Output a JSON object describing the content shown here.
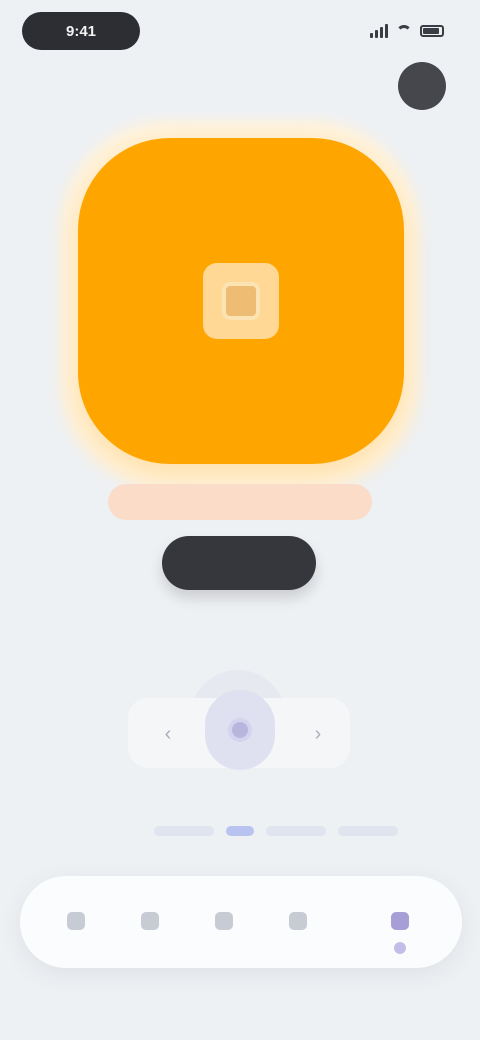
{
  "status_bar": {
    "time": "9:41",
    "signal_icon": "signal-icon",
    "wifi_icon": "wifi-icon",
    "battery_icon": "battery-icon"
  },
  "header": {
    "back_label": "",
    "title": "",
    "avatar_initials": ""
  },
  "hero": {
    "accent_color": "#ffa500",
    "icon": "square-icon",
    "caption": "",
    "primary_button_label": ""
  },
  "control_pad": {
    "left_icon": "chevron-left-icon",
    "right_icon": "chevron-right-icon",
    "center_icon": "record-icon",
    "caption": ""
  },
  "indicators": {
    "active_color": "#b8c3f0",
    "inactive_color": "#dfe4ee"
  },
  "bottom_nav": {
    "items": [
      {
        "label": "",
        "icon": "home-icon",
        "active": false
      },
      {
        "label": "",
        "icon": "compass-icon",
        "active": false
      },
      {
        "label": "",
        "icon": "grid-icon",
        "active": false
      },
      {
        "label": "",
        "icon": "bell-icon",
        "active": false
      },
      {
        "label": "",
        "icon": "profile-icon",
        "active": true
      }
    ],
    "active_color": "#a79ed6"
  }
}
